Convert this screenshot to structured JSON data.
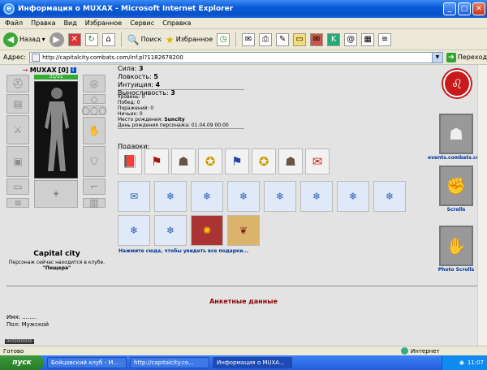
{
  "window": {
    "title": "Информация о MUXAX - Microsoft Internet Explorer",
    "min": "_",
    "max": "□",
    "close": "✕"
  },
  "menu": [
    "Файл",
    "Правка",
    "Вид",
    "Избранное",
    "Сервис",
    "Справка"
  ],
  "toolbar": {
    "back": "Назад",
    "search": "Поиск",
    "favorites": "Избранное"
  },
  "address": {
    "label": "Адрес:",
    "url": "http://capitalcity.combats.com/inf.pl?1182678200",
    "go": "Переход"
  },
  "character": {
    "name": "MUXAX",
    "level": "[0]",
    "hp": "31/31",
    "city": "Capital city",
    "where": "Персонаж сейчас находится в клубе.",
    "room": "\"Пещера\""
  },
  "stats": {
    "strength": {
      "label": "Сила:",
      "value": "3"
    },
    "agility": {
      "label": "Ловкость:",
      "value": "5"
    },
    "intuition": {
      "label": "Интуиция:",
      "value": "4"
    },
    "endurance": {
      "label": "Выносливость:",
      "value": "3"
    }
  },
  "details": {
    "level": "Уровень: 0",
    "wins": "Побед: 0",
    "losses": "Поражений: 0",
    "draws": "Ничьих: 0",
    "birthplace_label": "Место рождения:",
    "birthplace": "Suncity",
    "birthday": "День рождения персонажа: 01.04.09 00:00"
  },
  "gifts": {
    "label": "Подарки:",
    "more": "Нажмите сюда, чтобы увидеть все подарки..."
  },
  "banners": {
    "events": "events.combats.com",
    "scrolls": "Scrolls",
    "photo": "Photo Scrolls"
  },
  "profile": {
    "title": "Анкетные данные",
    "name_label": "Имя:",
    "name_value": "........",
    "gender_label": "Пол:",
    "gender_value": "Мужской",
    "counter": "0000000000"
  },
  "status": {
    "left": "Готово",
    "zone": "Интернет"
  },
  "taskbar": {
    "start": "пуск",
    "tasks": [
      "Бойцовский клуб - M...",
      "http://capitalcity.co...",
      "Информация о MUXA..."
    ],
    "clock": "11:07"
  }
}
